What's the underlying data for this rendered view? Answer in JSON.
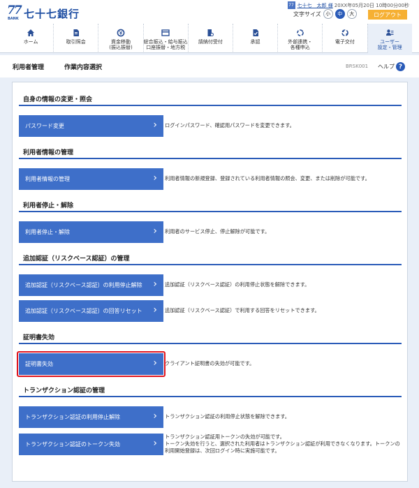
{
  "header": {
    "logo_num": "77",
    "logo_sub": "BANK",
    "logo_text": "七十七銀行",
    "user_icon": "77",
    "user_name": "七十七　太郎 様",
    "login_time": "20XX年05月20日 10時00分00秒",
    "font_size_label": "文字サイズ",
    "font_sizes": [
      "小",
      "中",
      "大"
    ],
    "logout": "ログアウト"
  },
  "gnav": [
    {
      "label": "ホーム",
      "icon": "home-icon"
    },
    {
      "label": "取引照会",
      "icon": "document-icon"
    },
    {
      "label": "資金移動\n(振込振替)",
      "icon": "yen-transfer-icon"
    },
    {
      "label": "総合振込・給与振込\n口座振替・地方税",
      "icon": "card-icon"
    },
    {
      "label": "請納付受付",
      "icon": "payment-icon"
    },
    {
      "label": "承認",
      "icon": "approval-icon"
    },
    {
      "label": "外部連携・\n各種申込",
      "icon": "link-icon"
    },
    {
      "label": "電子交付",
      "icon": "exchange-icon"
    },
    {
      "label": "ユーザー\n設定・管理",
      "icon": "user-settings-icon"
    }
  ],
  "titlebar": {
    "category": "利用者管理",
    "title": "作業内容選択",
    "code": "BRSK001",
    "help": "ヘルプ",
    "help_icon": "?"
  },
  "sections": {
    "s1": "自身の情報の変更・照会",
    "s2": "利用者情報の管理",
    "s3": "利用者停止・解除",
    "s4": "追加認証（リスクベース認証）の管理",
    "s5": "証明書失効",
    "s6": "トランザクション認証の管理"
  },
  "actions": {
    "password": {
      "label": "パスワード変更",
      "desc": "ログインパスワード、確認用パスワードを変更できます。"
    },
    "user_info": {
      "label": "利用者情報の管理",
      "desc": "利用者情報の新規登録、登録されている利用者情報の照会、変更、または削除が可能です。"
    },
    "user_stop": {
      "label": "利用者停止・解除",
      "desc": "利用者のサービス停止、停止解除が可能です。"
    },
    "rba_unlock": {
      "label": "追加認証（リスクベース認証）の利用停止解除",
      "desc": "追加認証（リスクベース認証）の利用停止状態を解除できます。"
    },
    "rba_reset": {
      "label": "追加認証（リスクベース認証）の回答リセット",
      "desc": "追加認証（リスクベース認証）で利用する回答をリセットできます。"
    },
    "cert_revoke": {
      "label": "証明書失効",
      "desc": "クライアント証明書の失効が可能です。"
    },
    "tx_unlock": {
      "label": "トランザクション認証の利用停止解除",
      "desc": "トランザクション認証の利用停止状態を解除できます。"
    },
    "tx_token": {
      "label": "トランザクション認証のトークン失効",
      "desc1": "トランザクション認証用トークンの失効が可能です。",
      "desc2": "トークン失効を行うと、選択された利用者はトランザクション認証が利用できなくなります。トークンの利用開始登録は、次回ログイン時に実施可能です。"
    }
  }
}
